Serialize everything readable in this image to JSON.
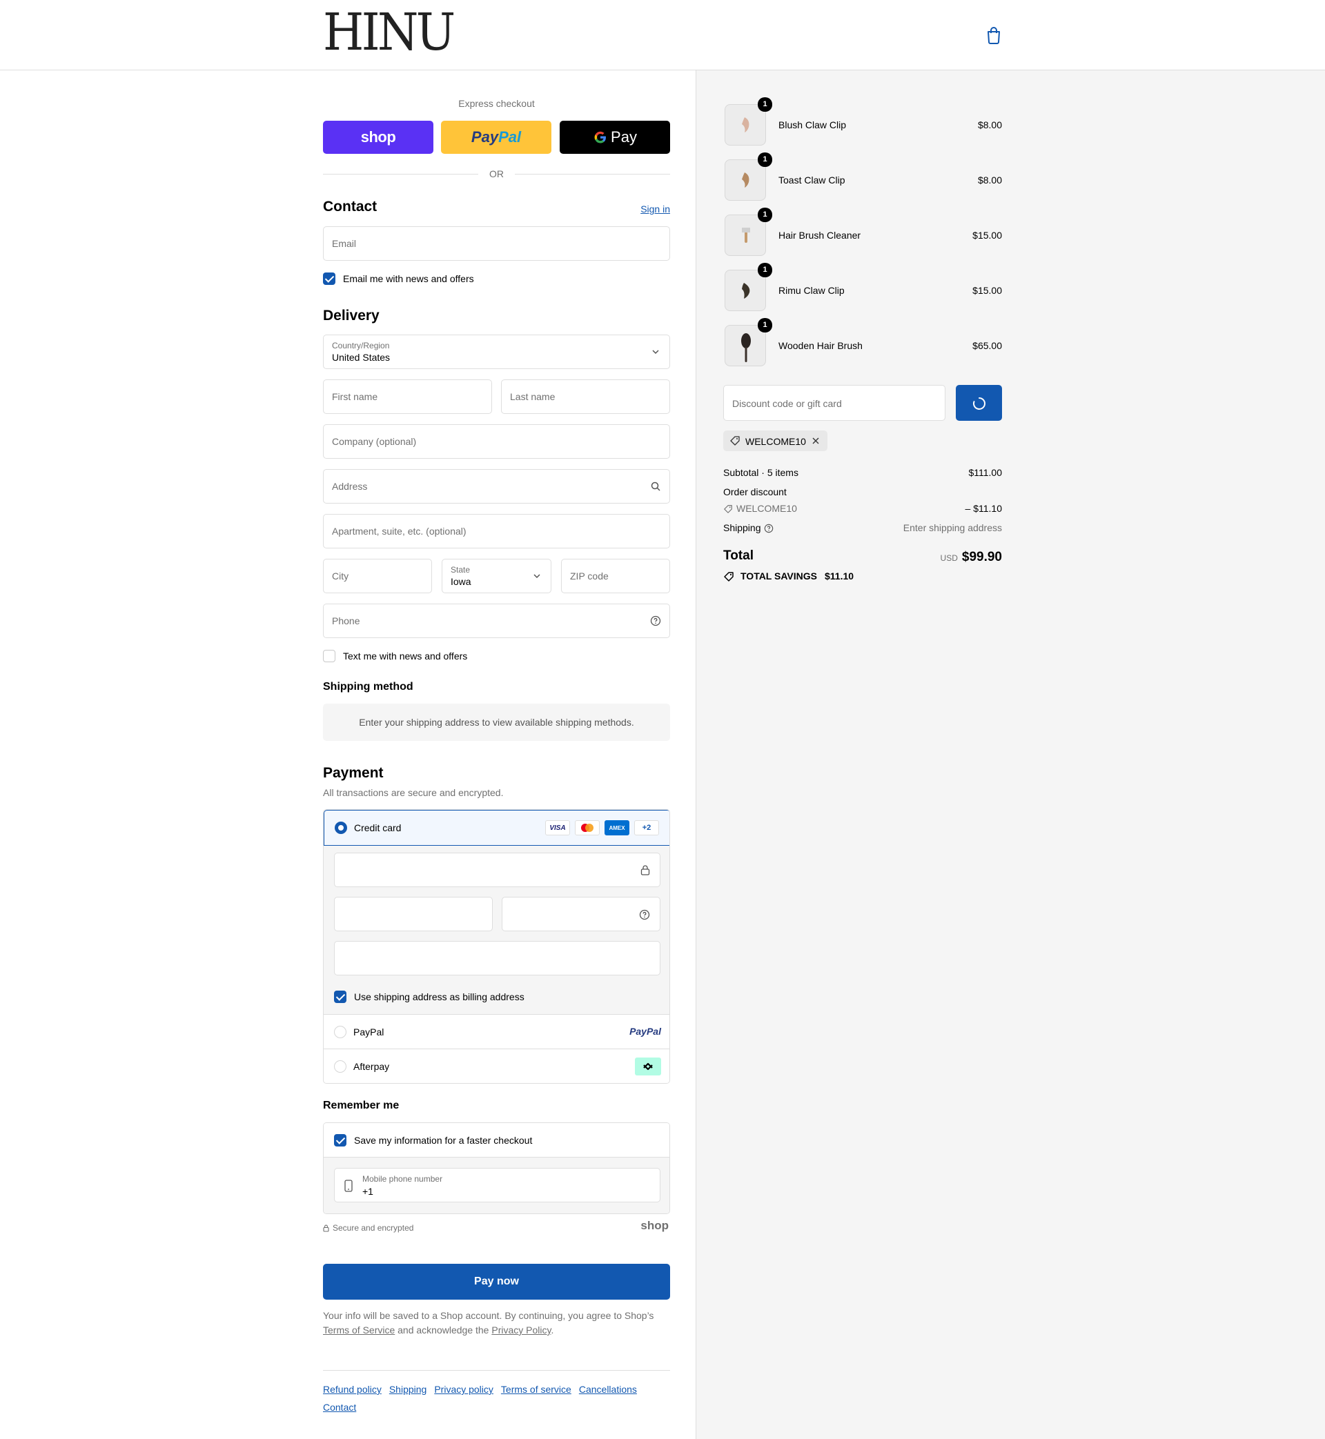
{
  "header": {
    "logo": "HINU",
    "cart_icon": "shopping-bag-icon"
  },
  "express": {
    "title": "Express checkout",
    "shop_label": "shop",
    "paypal_label_1": "Pay",
    "paypal_label_2": "Pal",
    "gpay_label": "Pay",
    "or_label": "OR"
  },
  "contact": {
    "title": "Contact",
    "sign_in": "Sign in",
    "email_placeholder": "Email",
    "news_opt_in": "Email me with news and offers",
    "news_opt_in_checked": true
  },
  "delivery": {
    "title": "Delivery",
    "country_label": "Country/Region",
    "country_value": "United States",
    "first_name": "First name",
    "last_name": "Last name",
    "company": "Company (optional)",
    "address": "Address",
    "apartment": "Apartment, suite, etc. (optional)",
    "city": "City",
    "state_label": "State",
    "state_value": "Iowa",
    "zip": "ZIP code",
    "phone": "Phone",
    "sms_opt_in": "Text me with news and offers",
    "sms_opt_in_checked": false
  },
  "shipping_method": {
    "title": "Shipping method",
    "notice": "Enter your shipping address to view available shipping methods."
  },
  "payment": {
    "title": "Payment",
    "subtitle": "All transactions are secure and encrypted.",
    "credit_card_label": "Credit card",
    "card_brands": [
      "VISA",
      "Mastercard",
      "AMEX",
      "+2"
    ],
    "billing_same": "Use shipping address as billing address",
    "billing_same_checked": true,
    "paypal_label": "PayPal",
    "paypal_logo": "PayPal",
    "afterpay_label": "Afterpay"
  },
  "remember": {
    "title": "Remember me",
    "save_info": "Save my information for a faster checkout",
    "save_info_checked": true,
    "mobile_label": "Mobile phone number",
    "mobile_value": "+1",
    "secure_label": "Secure and encrypted",
    "shop_logo": "shop"
  },
  "pay_now": "Pay now",
  "legal": {
    "text_1": "Your info will be saved to a Shop account. By continuing, you agree to Shop’s",
    "terms": "Terms of Service",
    "text_2": "and acknowledge the",
    "privacy": "Privacy Policy",
    "text_3": "."
  },
  "footer_links": [
    "Refund policy",
    "Shipping",
    "Privacy policy",
    "Terms of service",
    "Cancellations",
    "Contact"
  ],
  "cart": {
    "items": [
      {
        "name": "Blush Claw Clip",
        "price": "$8.00",
        "qty": "1"
      },
      {
        "name": "Toast Claw Clip",
        "price": "$8.00",
        "qty": "1"
      },
      {
        "name": "Hair Brush Cleaner",
        "price": "$15.00",
        "qty": "1"
      },
      {
        "name": "Rimu Claw Clip",
        "price": "$15.00",
        "qty": "1"
      },
      {
        "name": "Wooden Hair Brush",
        "price": "$65.00",
        "qty": "1"
      }
    ],
    "discount_placeholder": "Discount code or gift card",
    "applied_code": "WELCOME10"
  },
  "totals": {
    "subtotal_label": "Subtotal · 5 items",
    "subtotal_value": "$111.00",
    "order_discount_label": "Order discount",
    "discount_code": "WELCOME10",
    "discount_value": "– $11.10",
    "shipping_label": "Shipping",
    "shipping_value": "Enter shipping address",
    "total_label": "Total",
    "currency": "USD",
    "total_value": "$99.90",
    "savings_label": "TOTAL SAVINGS",
    "savings_value": "$11.10"
  },
  "colors": {
    "accent": "#1258b0",
    "shop_purple": "#5a31f4",
    "paypal_yellow": "#ffc439",
    "summary_bg": "#f5f5f5"
  }
}
